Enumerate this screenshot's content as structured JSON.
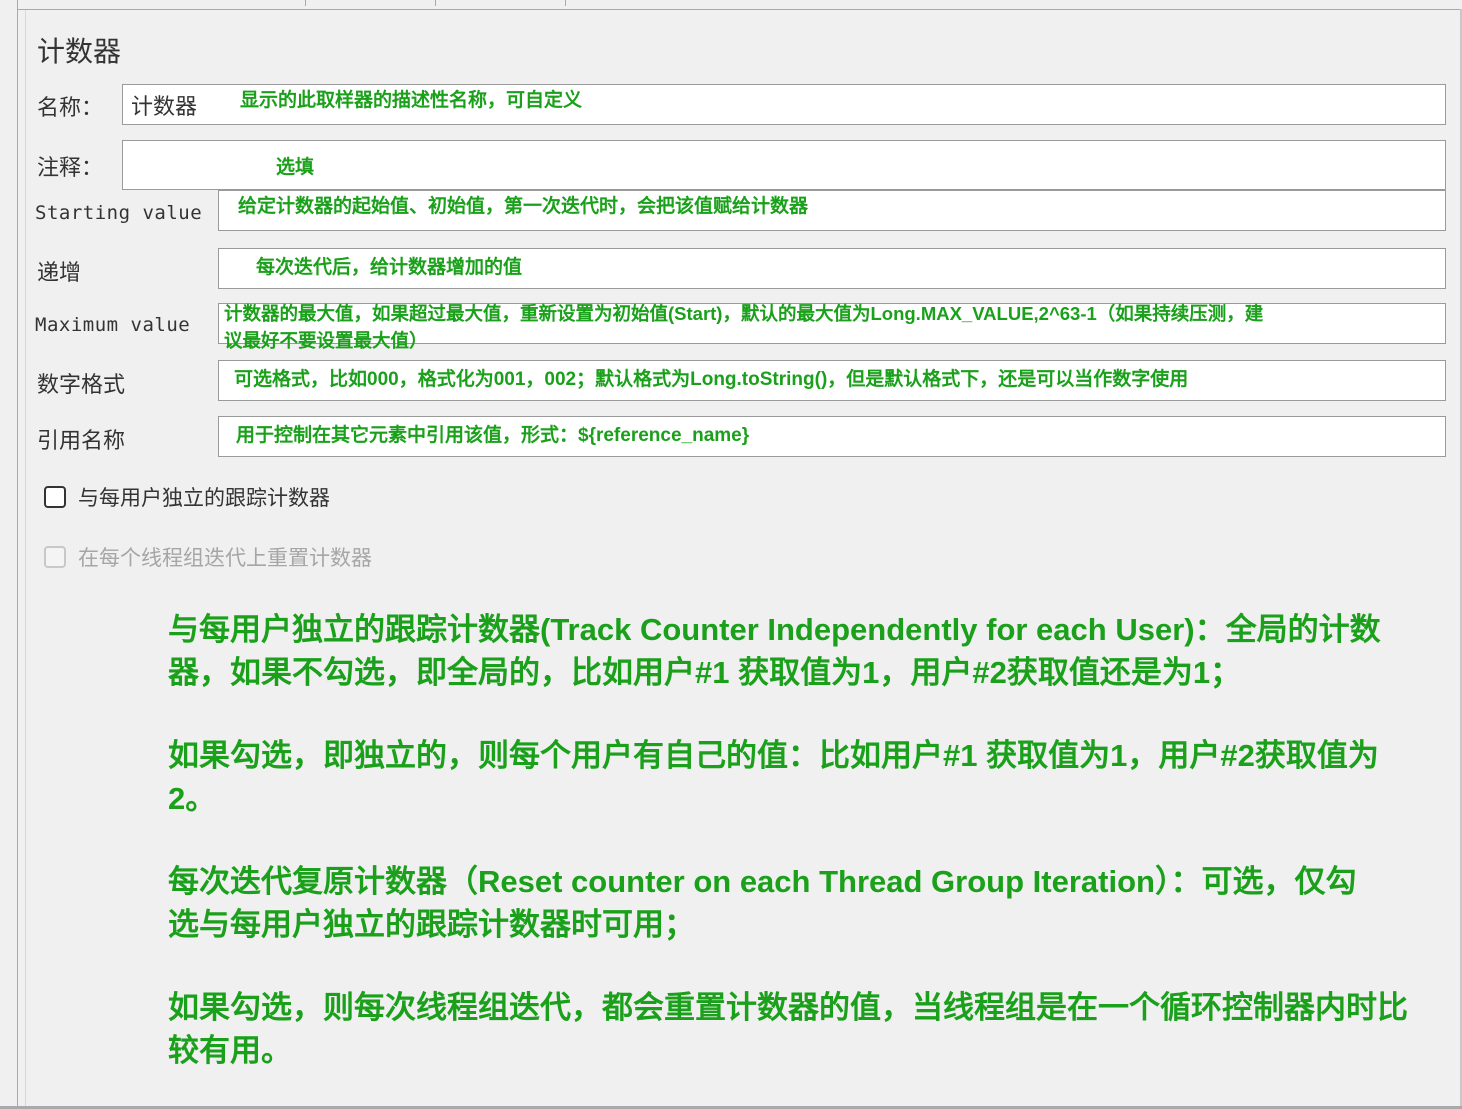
{
  "panel": {
    "title": "计数器"
  },
  "fields": {
    "name": {
      "label": "名称：",
      "value": "计数器",
      "note": "显示的此取样器的描述性名称，可自定义"
    },
    "comment": {
      "label": "注释：",
      "value": "",
      "note": "选填"
    },
    "start": {
      "label": "Starting value",
      "value": "",
      "note": "给定计数器的起始值、初始值，第一次迭代时，会把该值赋给计数器"
    },
    "increment": {
      "label": "递增",
      "value": "",
      "note": "每次迭代后，给计数器增加的值"
    },
    "max": {
      "label": "Maximum value",
      "value": "",
      "note_line1": "计数器的最大值，如果超过最大值，重新设置为初始值(Start)，默认的最大值为Long.MAX_VALUE,2^63-1（如果持续压测，建",
      "note_line2": "议最好不要设置最大值）"
    },
    "format": {
      "label": "数字格式",
      "value": "",
      "note": "可选格式，比如000，格式化为001，002；默认格式为Long.toString()，但是默认格式下，还是可以当作数字使用"
    },
    "refname": {
      "label": "引用名称",
      "value": "",
      "note": "用于控制在其它元素中引用该值，形式：${reference_name}"
    }
  },
  "checkboxes": {
    "per_user": {
      "label": "与每用户独立的跟踪计数器",
      "checked": false,
      "enabled": true
    },
    "reset": {
      "label": "在每个线程组迭代上重置计数器",
      "checked": false,
      "enabled": false
    }
  },
  "explanation": {
    "p1_line1": "与每用户独立的跟踪计数器(Track Counter Independently for each User)：全局的计数",
    "p1_line2": "器，如果不勾选，即全局的，比如用户#1 获取值为1，用户#2获取值还是为1；",
    "p2_line1": "如果勾选，即独立的，则每个用户有自己的值：比如用户#1 获取值为1，用户#2获取值为",
    "p2_line2": "2。",
    "p3_line1": "每次迭代复原计数器（Reset counter on each Thread Group Iteration）：可选，仅勾",
    "p3_line2": "选与每用户独立的跟踪计数器时可用；",
    "p4_line1": "如果勾选，则每次线程组迭代，都会重置计数器的值，当线程组是在一个循环控制器内时比",
    "p4_line2": "较有用。"
  },
  "colors": {
    "annotation": "#1aa01a",
    "background": "#f0f0f0"
  }
}
